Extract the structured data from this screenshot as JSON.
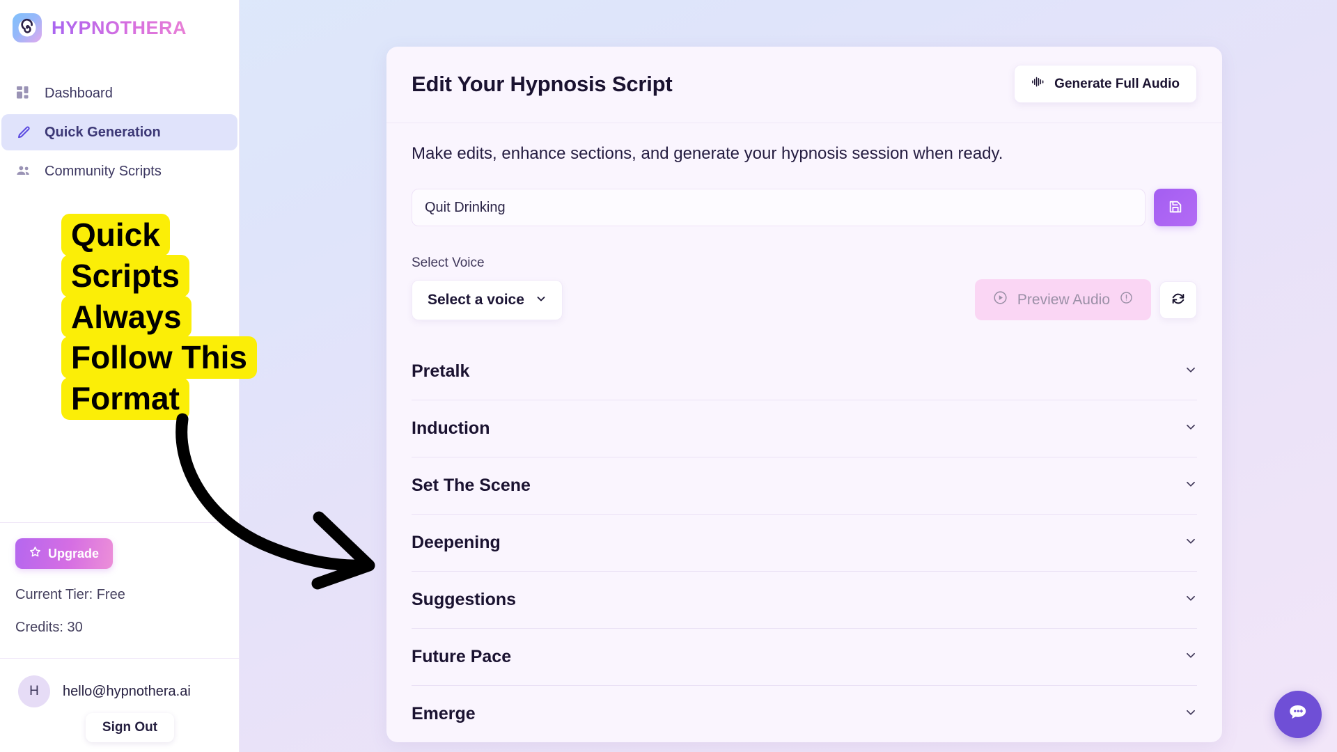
{
  "brand": {
    "name": "HYPNOTHERA",
    "logo_icon": "spiral-icon"
  },
  "sidebar": {
    "items": [
      {
        "label": "Dashboard",
        "icon": "grid-dashboard-icon",
        "active": false
      },
      {
        "label": "Quick Generation",
        "icon": "pencil-icon",
        "active": true
      },
      {
        "label": "Community Scripts",
        "icon": "people-group-icon",
        "active": false
      }
    ],
    "upgrade_label": "Upgrade",
    "upgrade_icon": "star-icon",
    "tier_text": "Current Tier: Free",
    "credits_text": "Credits: 30",
    "user": {
      "avatar_initial": "H",
      "email": "hello@hypnothera.ai",
      "signout_label": "Sign Out"
    }
  },
  "card": {
    "title": "Edit Your Hypnosis Script",
    "generate_audio_label": "Generate Full Audio",
    "generate_audio_icon": "audio-waveform-icon",
    "subtitle": "Make edits, enhance sections, and generate your hypnosis session when ready.",
    "script_title_value": "Quit Drinking",
    "script_title_placeholder": "Script title",
    "save_icon": "floppy-disk-save-icon",
    "voice_label": "Select Voice",
    "voice_selected": "Select a voice",
    "voice_chevron_icon": "chevron-down-icon",
    "preview_audio_label": "Preview Audio",
    "preview_play_icon": "play-circle-icon",
    "preview_info_icon": "exclamation-circle-icon",
    "refresh_icon": "refresh-icon",
    "sections": [
      {
        "name": "Pretalk",
        "chevron_icon": "chevron-down-icon"
      },
      {
        "name": "Induction",
        "chevron_icon": "chevron-down-icon"
      },
      {
        "name": "Set The Scene",
        "chevron_icon": "chevron-down-icon"
      },
      {
        "name": "Deepening",
        "chevron_icon": "chevron-down-icon"
      },
      {
        "name": "Suggestions",
        "chevron_icon": "chevron-down-icon"
      },
      {
        "name": "Future Pace",
        "chevron_icon": "chevron-down-icon"
      },
      {
        "name": "Emerge",
        "chevron_icon": "chevron-down-icon"
      }
    ]
  },
  "annotation": {
    "lines": [
      "Quick",
      "Scripts",
      "Always",
      "Follow This",
      "Format"
    ],
    "highlight_color": "#fbee07",
    "arrow_color": "#000000"
  },
  "chat_widget": {
    "icon": "chat-bubble-icon",
    "color": "#6f4fd6"
  }
}
